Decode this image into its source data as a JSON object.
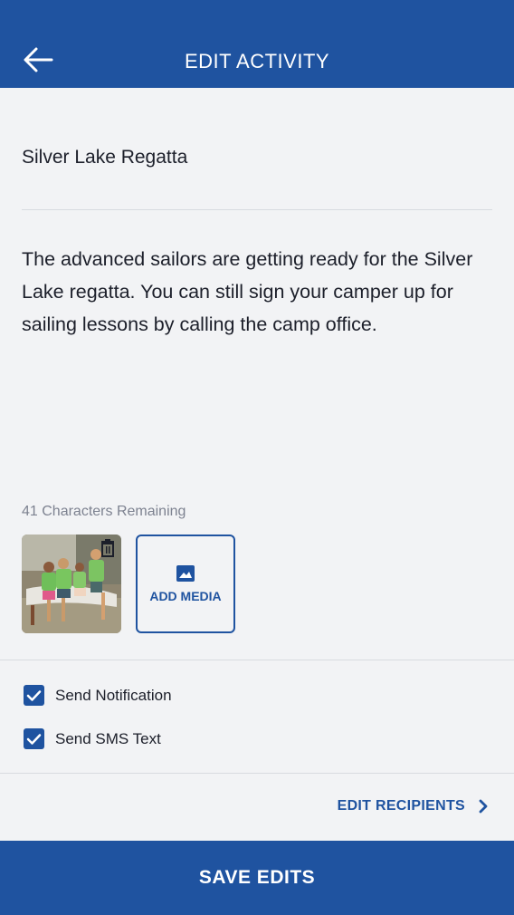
{
  "header": {
    "title": "EDIT ACTIVITY",
    "back_icon": "arrow-left-icon"
  },
  "form": {
    "title_value": "Silver Lake Regatta",
    "description_value": "The advanced sailors are getting ready for the Silver Lake regatta. You can still sign your camper up for sailing lessons by calling the camp office.",
    "char_count": "41 Characters Remaining"
  },
  "media": {
    "thumbnail_icon": "photo-thumbnail",
    "delete_icon": "trash-icon",
    "add_media_label": "ADD MEDIA",
    "add_media_icon": "image-icon"
  },
  "options": {
    "send_notification": {
      "label": "Send Notification",
      "checked": true
    },
    "send_sms": {
      "label": "Send SMS Text",
      "checked": true
    }
  },
  "recipients": {
    "label": "EDIT RECIPIENTS",
    "icon": "chevron-right-icon"
  },
  "footer": {
    "save_label": "SAVE EDITS"
  },
  "colors": {
    "primary": "#1f53a0",
    "background": "#f2f3f5",
    "text": "#1c1f2a",
    "muted": "#7d8290"
  }
}
